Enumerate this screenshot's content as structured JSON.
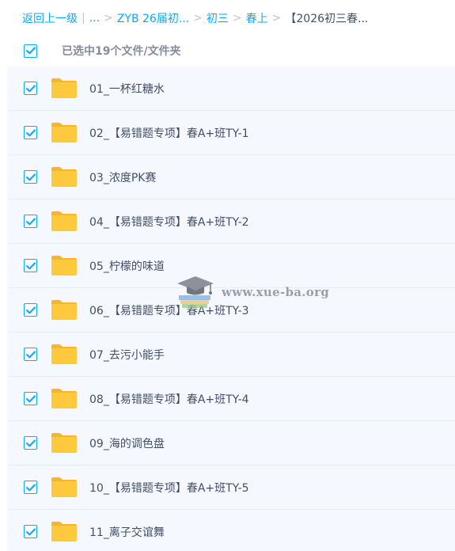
{
  "breadcrumb": {
    "back_label": "返回上一级",
    "separator_pipe": "|",
    "ellipsis": "...",
    "sep": ">",
    "items": [
      "ZYB 26届初...",
      "初三",
      "春上"
    ],
    "current": "【2026初三春..."
  },
  "selection": {
    "count_label": "已选中19个文件/文件夹",
    "checked": true
  },
  "files": [
    {
      "name": "01_一杯红糖水",
      "checked": true,
      "icon": "folder-icon"
    },
    {
      "name": "02_【易错题专项】春A+班TY-1",
      "checked": true,
      "icon": "folder-icon"
    },
    {
      "name": "03_浓度PK赛",
      "checked": true,
      "icon": "folder-icon"
    },
    {
      "name": "04_【易错题专项】春A+班TY-2",
      "checked": true,
      "icon": "folder-icon"
    },
    {
      "name": "05_柠檬的味道",
      "checked": true,
      "icon": "folder-icon"
    },
    {
      "name": "06_【易错题专项】春A+班TY-3",
      "checked": true,
      "icon": "folder-icon"
    },
    {
      "name": "07_去污小能手",
      "checked": true,
      "icon": "folder-icon"
    },
    {
      "name": "08_【易错题专项】春A+班TY-4",
      "checked": true,
      "icon": "folder-icon"
    },
    {
      "name": "09_海的调色盘",
      "checked": true,
      "icon": "folder-icon"
    },
    {
      "name": "10_【易错题专项】春A+班TY-5",
      "checked": true,
      "icon": "folder-icon"
    },
    {
      "name": "11_离子交谊舞",
      "checked": true,
      "icon": "folder-icon"
    }
  ],
  "watermark": {
    "text": "www.xue-ba.org",
    "icon": "graduation-cap-icon"
  },
  "colors": {
    "accent": "#09aaff",
    "folder": "#ffc93d",
    "text": "#424e67",
    "muted": "#878c9c",
    "row_selected_bg": "#f5f9ff"
  }
}
